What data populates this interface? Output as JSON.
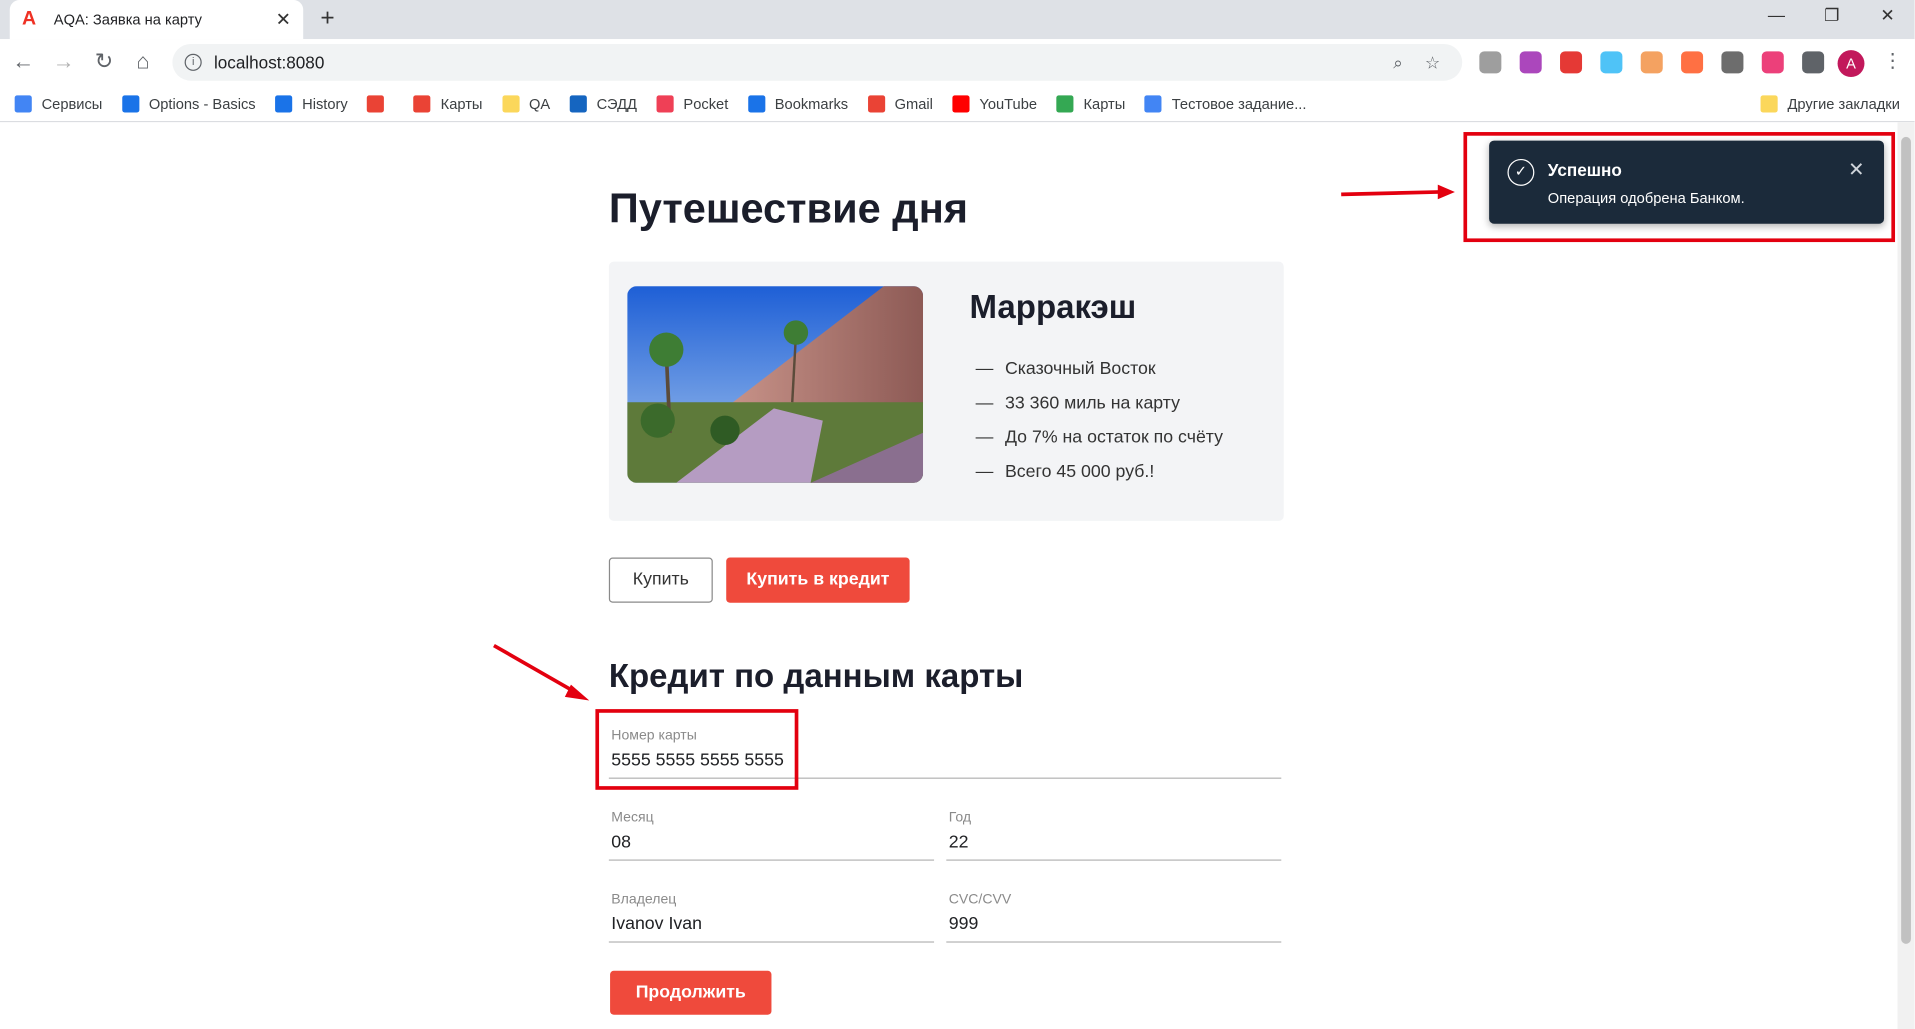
{
  "browser": {
    "tab_title": "AQA: Заявка на карту",
    "url": "localhost:8080",
    "bookmarks": [
      {
        "label": "Сервисы",
        "icon": "apps-grid-icon",
        "color": "#4285f4"
      },
      {
        "label": "Options - Basics",
        "icon": "gear-icon",
        "color": "#1a73e8"
      },
      {
        "label": "History",
        "icon": "history-icon",
        "color": "#1a73e8"
      },
      {
        "label": "",
        "icon": "google-icon",
        "color": "#ea4335"
      },
      {
        "label": "Карты",
        "icon": "map-pin-icon",
        "color": "#ea4335"
      },
      {
        "label": "QA",
        "icon": "folder-icon",
        "color": "#fbd75b"
      },
      {
        "label": "СЭДД",
        "icon": "briefcase-icon",
        "color": "#1565c0"
      },
      {
        "label": "Pocket",
        "icon": "pocket-icon",
        "color": "#ef4056"
      },
      {
        "label": "Bookmarks",
        "icon": "star-icon",
        "color": "#1a73e8"
      },
      {
        "label": "Gmail",
        "icon": "gmail-icon",
        "color": "#ea4335"
      },
      {
        "label": "YouTube",
        "icon": "youtube-icon",
        "color": "#ff0000"
      },
      {
        "label": "Карты",
        "icon": "maps-icon",
        "color": "#34a853"
      },
      {
        "label": "Тестовое задание...",
        "icon": "docs-icon",
        "color": "#4285f4"
      }
    ],
    "other_bookmarks": "Другие закладки",
    "avatar_letter": "A"
  },
  "page": {
    "title": "Путешествие дня",
    "city": "Марракэш",
    "features": [
      "Сказочный Восток",
      "33 360 миль на карту",
      "До 7% на остаток по счёту",
      "Всего 45 000 руб.!"
    ],
    "buy_button": "Купить",
    "credit_button": "Купить в кредит",
    "form_title": "Кредит по данным карты",
    "fields": {
      "card_number": {
        "label": "Номер карты",
        "value": "5555 5555 5555 5555"
      },
      "month": {
        "label": "Месяц",
        "value": "08"
      },
      "year": {
        "label": "Год",
        "value": "22"
      },
      "owner": {
        "label": "Владелец",
        "value": "Ivanov Ivan"
      },
      "cvc": {
        "label": "CVC/CVV",
        "value": "999"
      }
    },
    "continue_button": "Продолжить"
  },
  "toast": {
    "title": "Успешно",
    "message": "Операция одобрена Банком."
  },
  "colors": {
    "accent": "#ef4a3c",
    "toast_bg": "#1b2a3a",
    "annotation": "#e3000f"
  }
}
